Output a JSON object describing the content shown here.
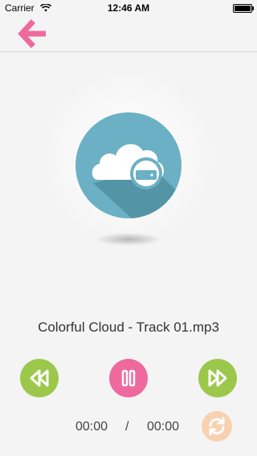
{
  "status_bar": {
    "carrier": "Carrier",
    "time": "12:46 AM"
  },
  "nav": {
    "back_icon": "back-arrow-icon",
    "accent": "#ee6a9e"
  },
  "artwork": {
    "icon": "cloud-drive-icon",
    "circle_color": "#6bb0c4"
  },
  "player": {
    "track_title": "Colorful Cloud - Track 01.mp3",
    "current_time": "00:00",
    "separator": "/",
    "total_time": "00:00",
    "controls": {
      "rewind_icon": "rewind-icon",
      "pause_icon": "pause-icon",
      "forward_icon": "fast-forward-icon",
      "repeat_icon": "repeat-icon"
    },
    "colors": {
      "green": "#9bc84a",
      "pink": "#ee6a9e",
      "orange": "#f8d2b0"
    }
  }
}
